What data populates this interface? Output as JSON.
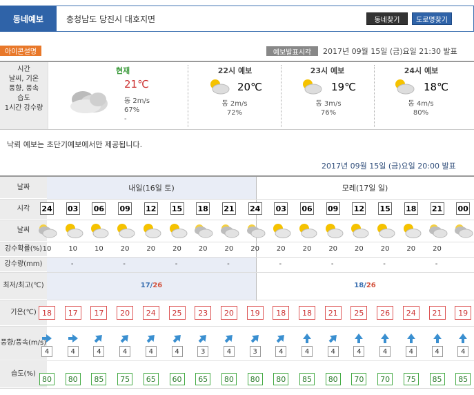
{
  "header": {
    "tab_label": "동네예보",
    "location": "충청남도 당진시 대호지면",
    "btn_town": "동네찾기",
    "btn_road": "도로명찾기"
  },
  "issue": {
    "icon_guide": "아이콘설명",
    "label": "예보발표시각",
    "time": "2017년 09월 15일 (금)요일 21:30 발표"
  },
  "current_labels": [
    "시간",
    "날씨, 기온",
    "풍향, 풍속",
    "습도",
    "1시간 강수량"
  ],
  "now": {
    "title": "현재",
    "temp": "21℃",
    "wind": "동 2m/s",
    "humidity": "67%",
    "rain": "-"
  },
  "nowcasts": [
    {
      "title": "22시 예보",
      "temp": "20℃",
      "wind": "동 2m/s",
      "humidity": "72%"
    },
    {
      "title": "23시 예보",
      "temp": "19℃",
      "wind": "동 3m/s",
      "humidity": "76%"
    },
    {
      "title": "24시 예보",
      "temp": "18℃",
      "wind": "동 4m/s",
      "humidity": "80%"
    }
  ],
  "notice": "낙뢰 예보는 초단기예보에서만 제공됩니다.",
  "forecast_time": "2017년 09월 15일 (금)요일 20:00 발표",
  "table": {
    "row_labels": {
      "date": "날짜",
      "time": "시각",
      "weather": "날씨",
      "pop": "강수확률(%)",
      "rain": "강수량(mm)",
      "minmax": "최저/최고(℃)",
      "temp": "기온(℃)",
      "wind": "풍향/풍속(m/s)",
      "humidity": "습도(%)"
    },
    "day1": {
      "label": "내일(16일 토)",
      "min": "17",
      "max": "26"
    },
    "day2": {
      "label": "모레(17일 일)",
      "min": "18",
      "max": "26"
    },
    "hours": [
      "24",
      "03",
      "06",
      "09",
      "12",
      "15",
      "18",
      "21",
      "24",
      "03",
      "06",
      "09",
      "12",
      "15",
      "18",
      "21",
      "00"
    ],
    "pop": [
      "10",
      "10",
      "10",
      "20",
      "20",
      "20",
      "20",
      "20",
      "20",
      "20",
      "20",
      "20",
      "20",
      "20",
      "20",
      "20"
    ],
    "rain": [
      "-",
      "-",
      "-",
      "-",
      "-",
      "-",
      "-",
      "-"
    ],
    "temps": [
      "18",
      "17",
      "17",
      "20",
      "24",
      "25",
      "23",
      "20",
      "19",
      "18",
      "18",
      "21",
      "25",
      "26",
      "24",
      "21",
      "19"
    ],
    "wind_speed": [
      "4",
      "4",
      "4",
      "4",
      "4",
      "4",
      "3",
      "4",
      "3",
      "4",
      "4",
      "4",
      "4",
      "4",
      "4",
      "4",
      "4"
    ],
    "wind_dir": [
      "W",
      "W",
      "SW",
      "SW",
      "SW",
      "SW",
      "SW",
      "SW",
      "SW",
      "SW",
      "S",
      "SW",
      "S",
      "S",
      "S",
      "S",
      "S"
    ],
    "humidity": [
      "80",
      "80",
      "85",
      "75",
      "65",
      "60",
      "65",
      "80",
      "80",
      "80",
      "85",
      "80",
      "70",
      "70",
      "75",
      "85",
      "85"
    ],
    "weather_icons": [
      "cloudy-icon",
      "partly-cloudy-icon",
      "partly-cloudy-icon",
      "partly-cloudy-icon",
      "partly-cloudy-icon",
      "partly-cloudy-icon",
      "cloudy-icon",
      "cloudy-icon",
      "cloudy-icon",
      "partly-cloudy-icon",
      "partly-cloudy-icon",
      "partly-cloudy-icon",
      "partly-cloudy-icon",
      "partly-cloudy-icon",
      "partly-cloudy-icon",
      "cloudy-icon",
      "cloudy-icon"
    ]
  }
}
